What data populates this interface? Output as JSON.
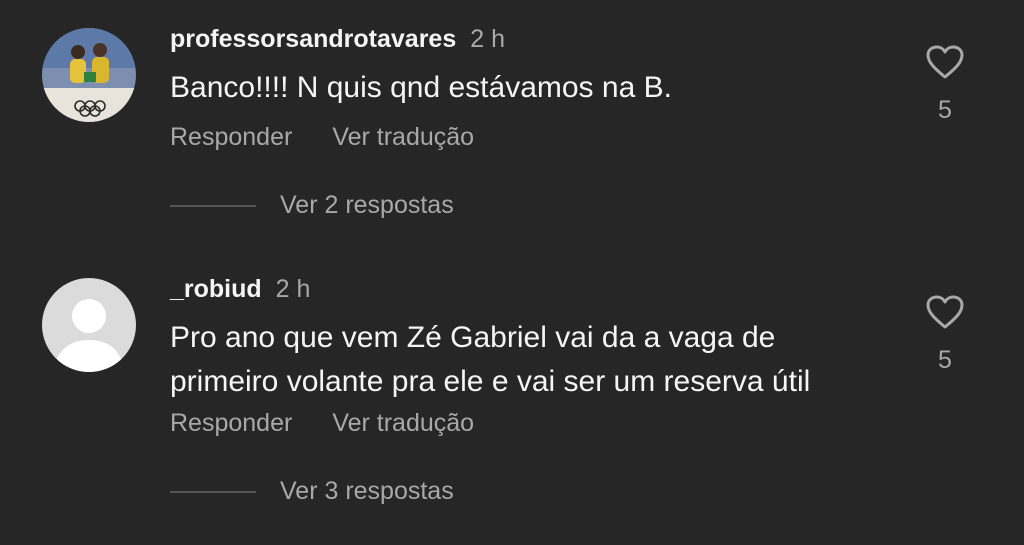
{
  "comments": [
    {
      "username": "professorsandrotavares",
      "time": "2 h",
      "text_lines": [
        "Banco!!!! N quis qnd estávamos na B."
      ],
      "reply_label": "Responder",
      "translate_label": "Ver tradução",
      "likes": "5",
      "view_replies": "Ver 2 respostas",
      "avatar": "photo"
    },
    {
      "username": "_robiud",
      "time": "2 h",
      "text_lines": [
        "Pro ano que vem Zé Gabriel vai da a vaga de",
        "primeiro volante pra ele e vai ser um reserva útil"
      ],
      "reply_label": "Responder",
      "translate_label": "Ver tradução",
      "likes": "5",
      "view_replies": "Ver 3 respostas",
      "avatar": "default"
    }
  ],
  "icons": {
    "like": "heart-outline-icon",
    "default_avatar": "person-silhouette-icon"
  },
  "colors": {
    "background": "#262626",
    "primary_text": "#f5f5f5",
    "secondary_text": "#a8a8a8"
  }
}
